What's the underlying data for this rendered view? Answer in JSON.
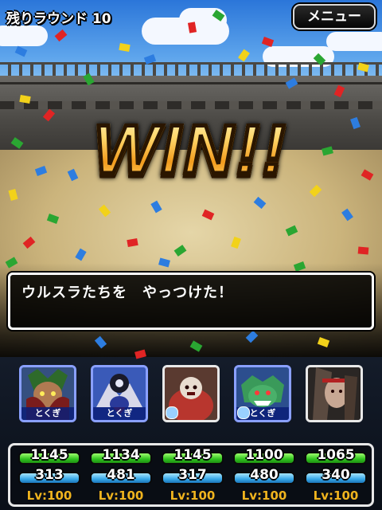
{
  "header": {
    "round_label": "残りラウンド 10",
    "menu_label": "メニュー"
  },
  "banner": {
    "text": "WIN!!"
  },
  "message": {
    "text": "ウルスラたちを　やっつけた！"
  },
  "party": [
    {
      "tag": "とくぎ",
      "hp": "1145",
      "mp": "313",
      "level": "Lv:100"
    },
    {
      "tag": "とくぎ",
      "hp": "1134",
      "mp": "481",
      "level": "Lv:100"
    },
    {
      "tag": "",
      "hp": "1145",
      "mp": "317",
      "level": "Lv:100"
    },
    {
      "tag": "とくぎ",
      "hp": "1100",
      "mp": "480",
      "level": "Lv:100"
    },
    {
      "tag": "",
      "hp": "1065",
      "mp": "340",
      "level": "Lv:100"
    }
  ],
  "colors": {
    "hp_bar": "#2fc21f",
    "mp_bar": "#38a8e8",
    "level_text": "#f0b41e",
    "win_gold": "#f6b53a"
  }
}
